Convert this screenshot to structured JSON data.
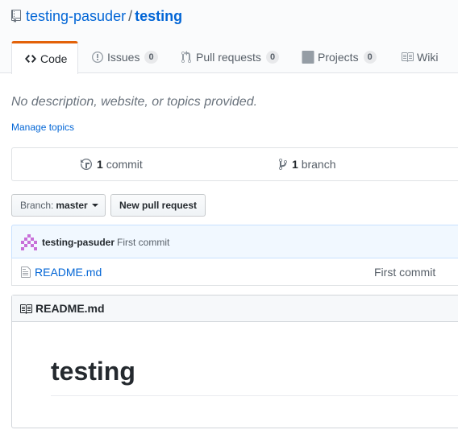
{
  "repo": {
    "owner": "testing-pasuder",
    "separator": "/",
    "name": "testing"
  },
  "tabs": [
    {
      "label": "Code",
      "icon": "code-icon",
      "selected": true
    },
    {
      "label": "Issues",
      "icon": "issue-opened-icon",
      "count": "0"
    },
    {
      "label": "Pull requests",
      "icon": "git-pull-request-icon",
      "count": "0"
    },
    {
      "label": "Projects",
      "icon": "project-icon",
      "count": "0"
    },
    {
      "label": "Wiki",
      "icon": "book-icon"
    }
  ],
  "description": "No description, website, or topics provided.",
  "manage_topics": "Manage topics",
  "summary": {
    "commits_count": "1",
    "commits_label": "commit",
    "branches_count": "1",
    "branches_label": "branch"
  },
  "branch_button": {
    "prefix": "Branch:",
    "value": "master"
  },
  "new_pr_button": "New pull request",
  "latest_commit": {
    "author": "testing-pasuder",
    "message": "First commit"
  },
  "files": [
    {
      "name": "README.md",
      "commit_message": "First commit"
    }
  ],
  "readme": {
    "title": "README.md",
    "heading": "testing"
  },
  "colors": {
    "link": "#0366d6",
    "tab_accent": "#e36209",
    "commit_bar_bg": "#f1f8ff"
  }
}
